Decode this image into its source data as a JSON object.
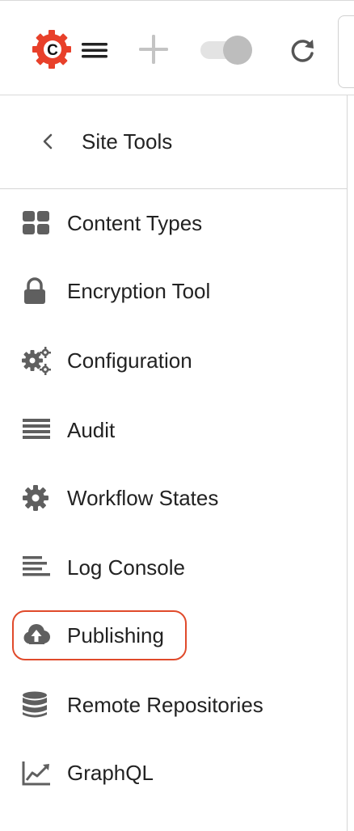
{
  "toolbar": {
    "logo_letter": "C",
    "icons": [
      "craftercms-logo-icon",
      "menu-icon",
      "add-icon",
      "toggle-switch",
      "refresh-icon"
    ],
    "colors": {
      "brand": "#e8402a",
      "icon_gray": "#c4c4c4",
      "icon_dark": "#222222"
    }
  },
  "header": {
    "back_icon": "chevron-left-icon",
    "title": "Site Tools"
  },
  "sidebar": {
    "items": [
      {
        "label": "Content Types",
        "icon": "grid-icon"
      },
      {
        "label": "Encryption Tool",
        "icon": "lock-icon"
      },
      {
        "label": "Configuration",
        "icon": "gears-icon"
      },
      {
        "label": "Audit",
        "icon": "list-lines-icon"
      },
      {
        "label": "Workflow States",
        "icon": "gear-icon"
      },
      {
        "label": "Log Console",
        "icon": "text-lines-icon"
      },
      {
        "label": "Publishing",
        "icon": "cloud-upload-icon",
        "highlighted": true
      },
      {
        "label": "Remote Repositories",
        "icon": "database-icon"
      },
      {
        "label": "GraphQL",
        "icon": "chart-line-icon"
      }
    ],
    "highlight_color": "#e04a2b"
  }
}
